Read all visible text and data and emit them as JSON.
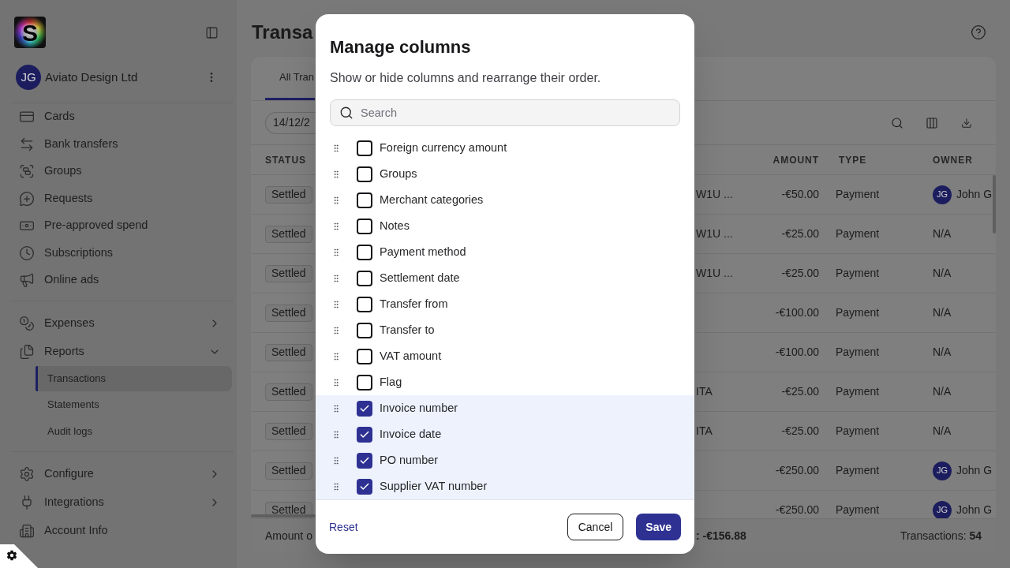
{
  "sidebar": {
    "logo_text": "S",
    "account": {
      "initials": "JG",
      "name": "Aviato Design Ltd"
    },
    "sections": [
      {
        "items": [
          {
            "label": "Cards",
            "kind": "link",
            "selected": false
          },
          {
            "label": "Bank transfers",
            "kind": "link",
            "selected": false
          },
          {
            "label": "Groups",
            "kind": "link",
            "selected": false
          },
          {
            "label": "Requests",
            "kind": "link",
            "selected": false
          },
          {
            "label": "Pre-approved spend",
            "kind": "link",
            "selected": false
          },
          {
            "label": "Subscriptions",
            "kind": "link",
            "selected": false
          },
          {
            "label": "Online ads",
            "kind": "link",
            "selected": false
          }
        ]
      },
      {
        "items": [
          {
            "label": "Expenses",
            "kind": "menu",
            "expanded": false,
            "selected": false
          },
          {
            "label": "Reports",
            "kind": "menu",
            "expanded": true,
            "selected": false,
            "children": [
              {
                "label": "Transactions",
                "selected": true
              },
              {
                "label": "Statements",
                "selected": false
              },
              {
                "label": "Audit logs",
                "selected": false
              }
            ]
          }
        ]
      },
      {
        "items": [
          {
            "label": "Configure",
            "kind": "menu",
            "expanded": false,
            "selected": false
          },
          {
            "label": "Integrations",
            "kind": "menu",
            "expanded": false,
            "selected": false
          },
          {
            "label": "Account Info",
            "kind": "link",
            "selected": false
          }
        ]
      }
    ]
  },
  "main": {
    "title": "Transa"
  },
  "tabs": [
    {
      "label": "All Tran",
      "selected": true
    }
  ],
  "toolbar": {
    "date_filter": "14/12/2"
  },
  "table": {
    "headings": {
      "status": "STATUS",
      "amount": "AMOUNT",
      "type": "TYPE",
      "owner": "OWNER"
    },
    "rows": [
      {
        "status": "Settled",
        "column_2": "W1U ...",
        "amount": "-€50.00",
        "type": "Payment",
        "owner": {
          "initials": "JG",
          "name": "John G"
        }
      },
      {
        "status": "Settled",
        "column_2": "W1U ...",
        "amount": "-€25.00",
        "type": "Payment",
        "owner": {
          "name": "N/A"
        }
      },
      {
        "status": "Settled",
        "column_2": "W1U ...",
        "amount": "-€25.00",
        "type": "Payment",
        "owner": {
          "name": "N/A"
        }
      },
      {
        "status": "Settled",
        "amount": "-€100.00",
        "type": "Payment",
        "owner": {
          "name": "N/A"
        }
      },
      {
        "status": "Settled",
        "amount": "-€100.00",
        "type": "Payment",
        "owner": {
          "name": "N/A"
        }
      },
      {
        "status": "Settled",
        "column_2": "ITA",
        "amount": "-€25.00",
        "type": "Payment",
        "owner": {
          "name": "N/A"
        }
      },
      {
        "status": "Settled",
        "column_2": "ITA",
        "amount": "-€25.00",
        "type": "Payment",
        "owner": {
          "name": "N/A"
        }
      },
      {
        "status": "Settled",
        "amount": "-€250.00",
        "type": "Payment",
        "owner": {
          "initials": "JG",
          "name": "John G"
        }
      },
      {
        "status": "Settled",
        "amount": "-€250.00",
        "type": "Payment",
        "owner": {
          "initials": "JG",
          "name": "John G"
        }
      }
    ]
  },
  "footer": {
    "amount_label": "Amount o",
    "amount_total": ": -€156.88",
    "count": "Transactions: **54**"
  },
  "modal": {
    "title": "Manage columns",
    "description": "Show or hide columns and rearrange their order.",
    "search": {
      "placeholder": "Search"
    },
    "columns": [
      {
        "label": "Foreign currency amount",
        "checked": false
      },
      {
        "label": "Groups",
        "checked": false
      },
      {
        "label": "Merchant categories",
        "checked": false
      },
      {
        "label": "Notes",
        "checked": false
      },
      {
        "label": "Payment method",
        "checked": false
      },
      {
        "label": "Settlement date",
        "checked": false
      },
      {
        "label": "Transfer from",
        "checked": false
      },
      {
        "label": "Transfer to",
        "checked": false
      },
      {
        "label": "VAT amount",
        "checked": false
      },
      {
        "label": "Flag",
        "checked": false
      },
      {
        "label": "Invoice number",
        "checked": true
      },
      {
        "label": "Invoice date",
        "checked": true
      },
      {
        "label": "PO number",
        "checked": true
      },
      {
        "label": "Supplier VAT number",
        "checked": true
      }
    ],
    "reset": "Reset",
    "buttons": [
      {
        "label": "Cancel",
        "kind": "secondary"
      },
      {
        "label": "Save",
        "kind": "primary"
      }
    ]
  }
}
